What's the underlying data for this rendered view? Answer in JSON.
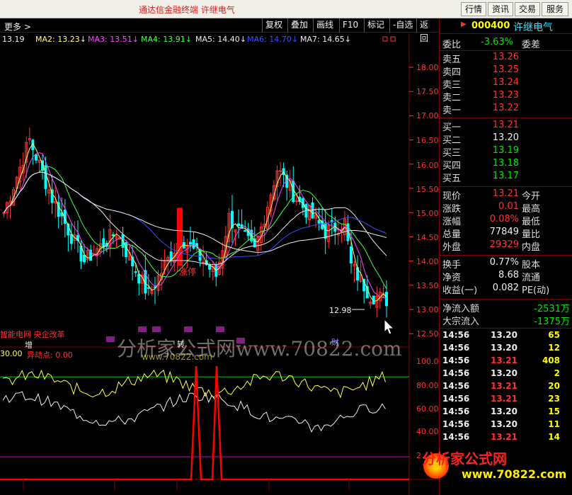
{
  "app": {
    "title": "通达信金融终端   许继电气",
    "top_buttons": [
      "行情",
      "资讯",
      "交易",
      "服务"
    ]
  },
  "toolbar": {
    "more": "更多 >",
    "buttons": [
      "复权",
      "叠加",
      "画线",
      "F10",
      "标记",
      "-自选",
      "返回"
    ]
  },
  "ma_legend": [
    {
      "text": "13.19",
      "color": "#eeeeee"
    },
    {
      "text": "MA2: 13.23↓",
      "color": "#ffff66"
    },
    {
      "text": "MA3: 13.51↓",
      "color": "#ff44ff"
    },
    {
      "text": "MA4: 13.91↓",
      "color": "#44ff44"
    },
    {
      "text": "MA5: 14.40↓",
      "color": "#eeeeee"
    },
    {
      "text": "MA6: 14.70↓",
      "color": "#3c4cff"
    },
    {
      "text": "MA7: 14.65↓",
      "color": "#eeeeee"
    }
  ],
  "price_axis": [
    "18.00",
    "17.50",
    "17.00",
    "16.50",
    "16.00",
    "15.50",
    "15.00",
    "14.50",
    "14.00",
    "13.50",
    "13.00",
    "12.50"
  ],
  "indicator_axis": [
    "100.00",
    "80.00",
    "60.00",
    "40.00",
    "2"
  ],
  "annotations": {
    "limit_up": "涨停",
    "low_marker": "12.98",
    "concept": "智能电网 央企改革",
    "zeng": "增",
    "cai": "财",
    "indicator_value": "30.00",
    "indicator_name": "异动点: 0.00",
    "zhi": "转"
  },
  "watermark": {
    "text1": "分析家公式网www.70822.com",
    "text2": "www.70822.com",
    "logo": "分析家公式网",
    "logo_url": "www.70822.com"
  },
  "stock": {
    "code": "000400",
    "name": "许继电气"
  },
  "order_book": {
    "weibi_label": "委比",
    "weibi": "-3.63%",
    "weicha_label": "委差",
    "asks": [
      {
        "label": "卖五",
        "price": "13.26"
      },
      {
        "label": "卖四",
        "price": "13.25"
      },
      {
        "label": "卖三",
        "price": "13.24"
      },
      {
        "label": "卖二",
        "price": "13.23"
      },
      {
        "label": "卖一",
        "price": "13.22"
      }
    ],
    "bids": [
      {
        "label": "买一",
        "price": "13.21",
        "color": "red"
      },
      {
        "label": "买二",
        "price": "13.20",
        "color": "white"
      },
      {
        "label": "买三",
        "price": "13.19",
        "color": "green"
      },
      {
        "label": "买四",
        "price": "13.18",
        "color": "green"
      },
      {
        "label": "买五",
        "price": "13.17",
        "color": "green"
      }
    ]
  },
  "quote": [
    {
      "k": "现价",
      "v": "13.21",
      "c": "red",
      "k2": "今开"
    },
    {
      "k": "涨跌",
      "v": "0.01",
      "c": "red",
      "k2": "最高"
    },
    {
      "k": "涨幅",
      "v": "0.08%",
      "c": "red",
      "k2": "最低"
    },
    {
      "k": "总量",
      "v": "77849",
      "c": "white",
      "k2": "量比"
    },
    {
      "k": "外盘",
      "v": "29329",
      "c": "red",
      "k2": "内盘"
    }
  ],
  "quote2": [
    {
      "k": "换手",
      "v": "0.77%",
      "c": "white",
      "k2": "股本"
    },
    {
      "k": "净资",
      "v": "8.68",
      "c": "white",
      "k2": "流通"
    },
    {
      "k": "收益(一)",
      "v": "0.082",
      "c": "white",
      "k2": "PE(动)"
    }
  ],
  "flow": [
    {
      "k": "净流入额",
      "v": "-2531万"
    },
    {
      "k": "大宗流入",
      "v": "-1375万"
    }
  ],
  "ticks": [
    {
      "t": "14:56",
      "p": "13.20",
      "pc": "white",
      "v": "65"
    },
    {
      "t": "14:56",
      "p": "13.20",
      "pc": "white",
      "v": "12"
    },
    {
      "t": "14:56",
      "p": "13.21",
      "pc": "red",
      "v": "408"
    },
    {
      "t": "14:56",
      "p": "13.20",
      "pc": "white",
      "v": "2"
    },
    {
      "t": "14:56",
      "p": "13.21",
      "pc": "red",
      "v": "20"
    },
    {
      "t": "14:56",
      "p": "13.21",
      "pc": "red",
      "v": "23"
    },
    {
      "t": "14:56",
      "p": "13.20",
      "pc": "white",
      "v": "15"
    },
    {
      "t": "14:56",
      "p": "13.20",
      "pc": "white",
      "v": "11"
    },
    {
      "t": "14:56",
      "p": "13.21",
      "pc": "red",
      "v": "14"
    }
  ],
  "colors": {
    "up": "#ff3232",
    "down": "#00ffff",
    "grid": "#800000",
    "axis_text": "#ff3232"
  }
}
